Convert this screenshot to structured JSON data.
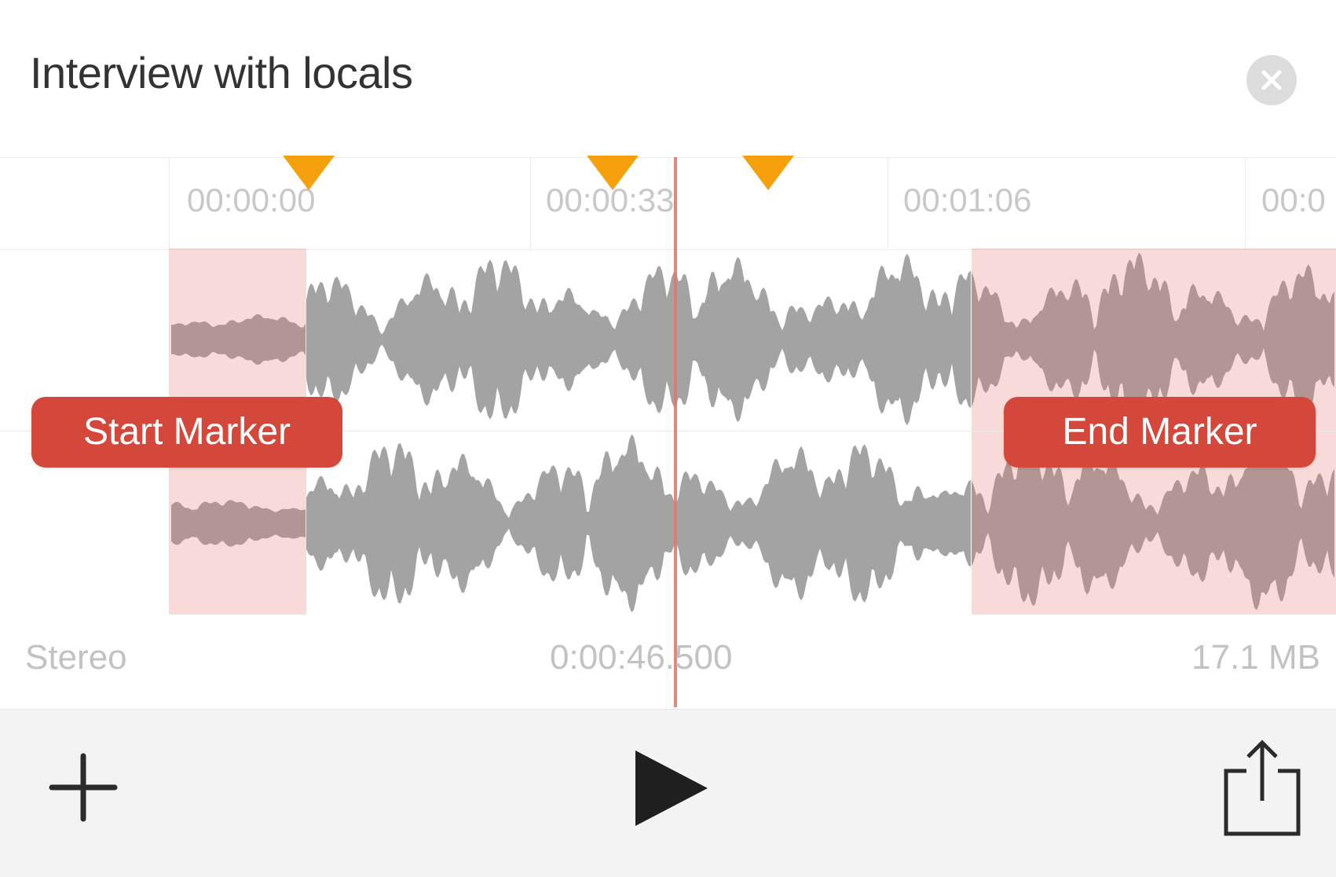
{
  "title": "Interview with locals",
  "icons": {
    "close": "close-icon",
    "add": "plus-icon",
    "play": "play-icon",
    "share": "share-icon",
    "flag": "marker-flag-icon"
  },
  "colors": {
    "accent": "#d4473b",
    "region_fill": "#f5d3d0",
    "flag": "#f5a00c",
    "playhead": "#e07a70",
    "waveform": "#a3a3a3",
    "waveform_trimmed": "#b39593"
  },
  "ruler": {
    "labels": [
      "00:00:00",
      "00:00:33",
      "00:01:06",
      "00:0"
    ]
  },
  "markers": {
    "start_label": "Start Marker",
    "end_label": "End Marker"
  },
  "info": {
    "channels": "Stereo",
    "position": "0:00:46.500",
    "size": "17.1 MB"
  }
}
